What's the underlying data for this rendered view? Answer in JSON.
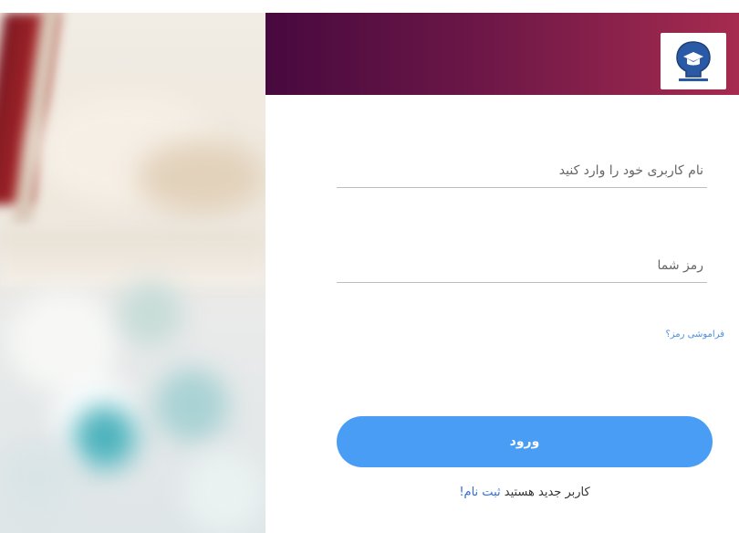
{
  "login": {
    "username_placeholder": "نام کاربری خود را وارد کنید",
    "password_placeholder": "رمز شما",
    "forgot_password": "فراموشی رمز؟",
    "login_button": "ورود",
    "register_prompt": "کاربر جدید هستید",
    "register_link": "ثبت نام!"
  },
  "icons": {
    "logo": "school-logo-icon"
  },
  "colors": {
    "header_gradient_start": "#47093f",
    "header_gradient_end": "#a62b4f",
    "button": "#4a9df5",
    "link": "#2f6fd6"
  }
}
